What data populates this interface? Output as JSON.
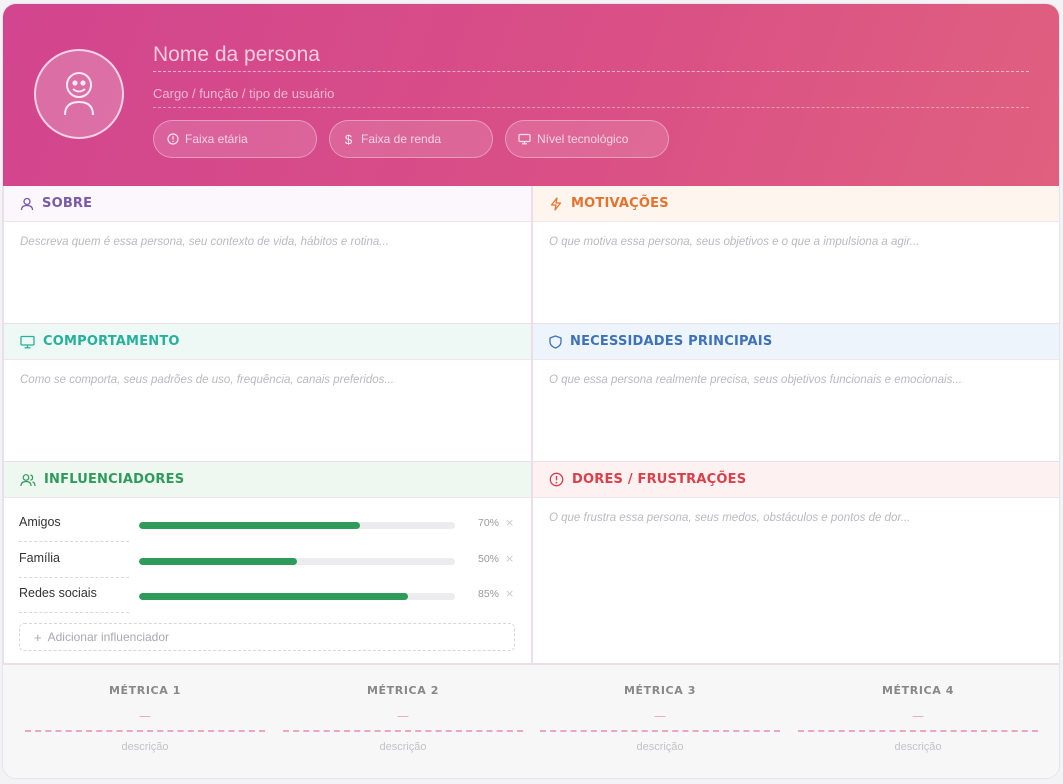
{
  "header": {
    "name_placeholder": "Nome da persona",
    "role_placeholder": "Cargo / função / tipo de usuário",
    "chips": [
      {
        "label": "Faixa etária",
        "icon": "alert-circle-icon"
      },
      {
        "label": "Faixa de renda",
        "icon": "dollar-icon"
      },
      {
        "label": "Nível tecnológico",
        "icon": "monitor-icon"
      }
    ]
  },
  "sections": {
    "sobre": {
      "title": "SOBRE",
      "color": "#7a5aa6",
      "bg": "#fbf7fd",
      "placeholder": "Descreva quem é essa persona, seu contexto de vida, hábitos e rotina..."
    },
    "motivacoes": {
      "title": "MOTIVAÇÕES",
      "color": "#e5722e",
      "bg": "#fdf5ee",
      "placeholder": "O que motiva essa persona, seus objetivos e o que a impulsiona a agir..."
    },
    "comportamento": {
      "title": "COMPORTAMENTO",
      "color": "#27b09a",
      "bg": "#eef9f6",
      "placeholder": "Como se comporta, seus padrões de uso, frequência, canais preferidos..."
    },
    "necessidades": {
      "title": "NECESSIDADES PRINCIPAIS",
      "color": "#3d72b8",
      "bg": "#eef4fb",
      "placeholder": "O que essa persona realmente precisa, seus objetivos funcionais e emocionais..."
    },
    "influenciadores": {
      "title": "INFLUENCIADORES",
      "color": "#2e9b5b",
      "bg": "#eef8f1"
    },
    "dores": {
      "title": "DORES / FRUSTRAÇÕES",
      "color": "#d9404a",
      "bg": "#fdf1f2",
      "placeholder": "O que frustra essa persona, seus medos, obstáculos e pontos de dor..."
    }
  },
  "influencers": [
    {
      "label": "Amigos",
      "value": 0.7,
      "pct": "70%"
    },
    {
      "label": "Família",
      "value": 0.5,
      "pct": "50%"
    },
    {
      "label": "Redes sociais",
      "value": 0.85,
      "pct": "85%"
    }
  ],
  "remove_symbol": "×",
  "add_influencer_label": "Adicionar influenciador",
  "metrics": [
    {
      "title": "MÉTRICA 1",
      "value": "—",
      "desc": "descrição"
    },
    {
      "title": "MÉTRICA 2",
      "value": "—",
      "desc": "descrição"
    },
    {
      "title": "MÉTRICA 3",
      "value": "—",
      "desc": "descrição"
    },
    {
      "title": "MÉTRICA 4",
      "value": "—",
      "desc": "descrição"
    }
  ]
}
